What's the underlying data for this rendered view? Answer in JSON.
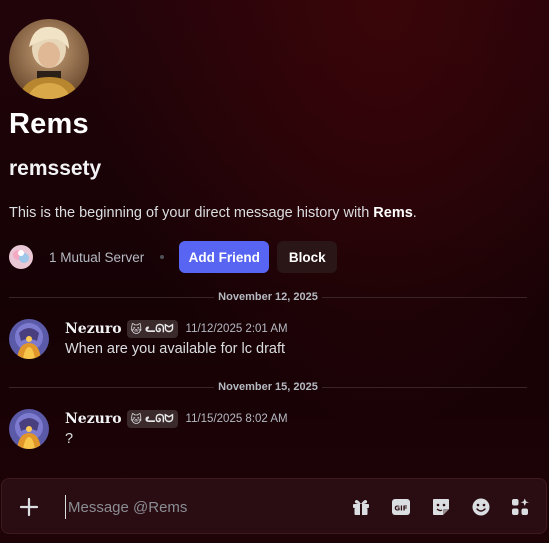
{
  "profile": {
    "display_name": "Rems",
    "username": "remssety",
    "intro_prefix": "This is the beginning of your direct message history with ",
    "intro_name": "Rems",
    "intro_suffix": "."
  },
  "actions": {
    "mutual_servers": "1 Mutual Server",
    "add_friend": "Add Friend",
    "block": "Block"
  },
  "messages": [
    {
      "date_divider": "November 12, 2025",
      "author": "Nezuro",
      "tag": "ᓚᘏᗢ",
      "tag_icon": "cat-emoji",
      "timestamp": "11/12/2025 2:01 AM",
      "text": "When are you available for lc draft"
    },
    {
      "date_divider": "November 15, 2025",
      "author": "Nezuro",
      "tag": "ᓚᘏᗢ",
      "tag_icon": "cat-emoji",
      "timestamp": "11/15/2025 8:02 AM",
      "text": "?"
    }
  ],
  "composer": {
    "placeholder": "Message @Rems",
    "icons": [
      "plus-icon",
      "gift-icon",
      "gif-icon",
      "sticker-icon",
      "emoji-icon",
      "apps-icon"
    ]
  },
  "colors": {
    "background": "#1a0306",
    "accent": "#5865f2",
    "secondary_button": "#2a1517"
  }
}
